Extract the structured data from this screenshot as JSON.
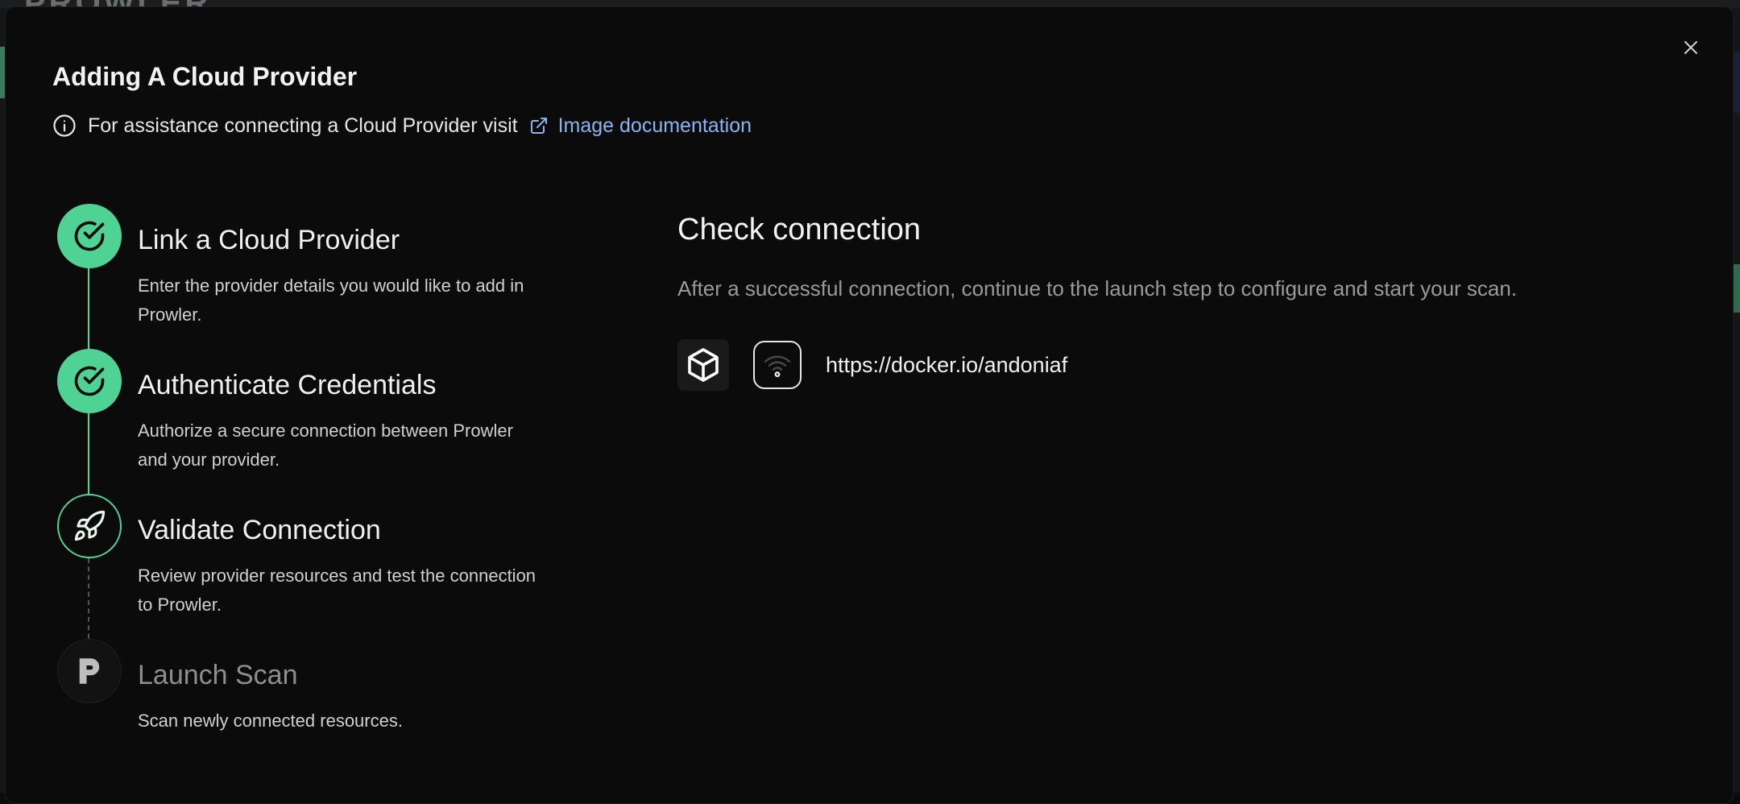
{
  "background": {
    "logo_text": "PROWLER"
  },
  "modal": {
    "title": "Adding A Cloud Provider",
    "assist_text": "For assistance connecting a Cloud Provider visit",
    "doc_link_label": "Image documentation",
    "close_icon": "close-icon"
  },
  "steps": [
    {
      "title": "Link a Cloud Provider",
      "description": "Enter the provider details you would like to add in Prowler.",
      "status": "done",
      "icon": "check-circle-icon"
    },
    {
      "title": "Authenticate Credentials",
      "description": "Authorize a secure connection between Prowler and your provider.",
      "status": "done",
      "icon": "check-circle-icon"
    },
    {
      "title": "Validate Connection",
      "description": "Review provider resources and test the connection to Prowler.",
      "status": "current",
      "icon": "rocket-icon"
    },
    {
      "title": "Launch Scan",
      "description": "Scan newly connected resources.",
      "status": "pending",
      "icon": "prowler-logo-icon"
    }
  ],
  "check": {
    "title": "Check connection",
    "description": "After a successful connection, continue to the launch step to configure and start your scan.",
    "provider_icon": "box-icon",
    "connection_icon": "wifi-icon",
    "provider_uid": "https://docker.io/andoniaf"
  },
  "colors": {
    "accent_green": "#4fd394",
    "link_blue": "#8ab4f0",
    "modal_bg": "#0b0b0b"
  }
}
